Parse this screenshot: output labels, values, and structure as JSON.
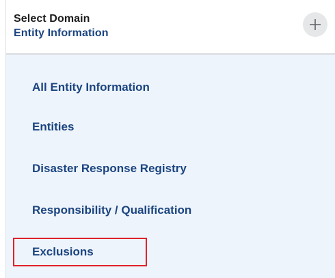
{
  "domain_selector": {
    "label": "Select Domain",
    "selected_value": "Entity Information",
    "expand_icon": "plus-icon"
  },
  "menu": {
    "items": [
      {
        "label": "All Entity Information"
      },
      {
        "label": "Entities"
      },
      {
        "label": "Disaster Response Registry"
      },
      {
        "label": "Responsibility / Qualification"
      },
      {
        "label": "Exclusions",
        "highlighted": true
      }
    ]
  },
  "colors": {
    "link": "#1a4480",
    "panel_background": "#eef4fb",
    "highlight_border": "#e0202a"
  }
}
